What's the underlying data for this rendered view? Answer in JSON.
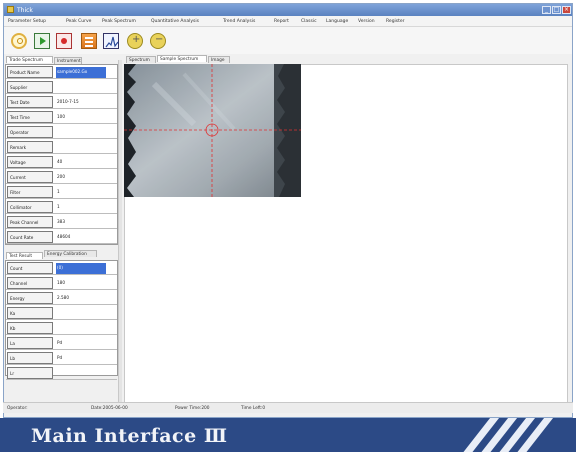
{
  "window": {
    "title": "Thick",
    "controls": [
      "_",
      "□",
      "×"
    ]
  },
  "menu": [
    "Parameter Setup",
    "Peak Curve",
    "Peak Spectrum",
    "Quantitative Analysis",
    "Trend Analysis",
    "Report",
    "Classic",
    "Language",
    "Version",
    "Register"
  ],
  "left_tabs": [
    "Trade Spectrum",
    "Instrument"
  ],
  "params": [
    {
      "label": "Product Name",
      "value": "sample002.Gx"
    },
    {
      "label": "Supplier",
      "value": ""
    },
    {
      "label": "Test Date",
      "value": "2010-7-15"
    },
    {
      "label": "Test Time",
      "value": "100"
    },
    {
      "label": "Operator",
      "value": ""
    },
    {
      "label": "Remark",
      "value": ""
    },
    {
      "label": "Voltage",
      "value": "40"
    },
    {
      "label": "Current",
      "value": "200"
    },
    {
      "label": "Filter",
      "value": "1"
    },
    {
      "label": "Collimator",
      "value": "1"
    },
    {
      "label": "Peak Channel",
      "value": "383"
    },
    {
      "label": "Count Rate",
      "value": "48604"
    }
  ],
  "result_tabs": [
    "Test Result",
    "Energy Calibration"
  ],
  "results": [
    {
      "label": "Count",
      "value": "(0)"
    },
    {
      "label": "Channel",
      "value": "180"
    },
    {
      "label": "Energy",
      "value": "2.580"
    },
    {
      "label": "Ka",
      "value": ""
    },
    {
      "label": "Kb",
      "value": ""
    },
    {
      "label": "La",
      "value": "Pd"
    },
    {
      "label": "Lb",
      "value": "Pd"
    },
    {
      "label": "Lr",
      "value": ""
    }
  ],
  "right_tabs": [
    "Spectrum",
    "Sample Spectrum",
    "Image"
  ],
  "status": {
    "operator": "Operator:",
    "date": "Date:2005-06-00",
    "power": "Power Time:200",
    "time_left": "Time Left:0"
  },
  "banner": {
    "title": "Main Interface Ⅲ"
  },
  "colors": {
    "titlebar": "#5a82c0",
    "banner": "#2c4a86",
    "selection": "#3c6fd6",
    "crosshair": "#e03030"
  },
  "icons": [
    "run-icon",
    "start-icon",
    "stop-icon",
    "calculator-icon",
    "spectrum-graph-icon",
    "zoom-in-icon",
    "zoom-out-icon"
  ]
}
